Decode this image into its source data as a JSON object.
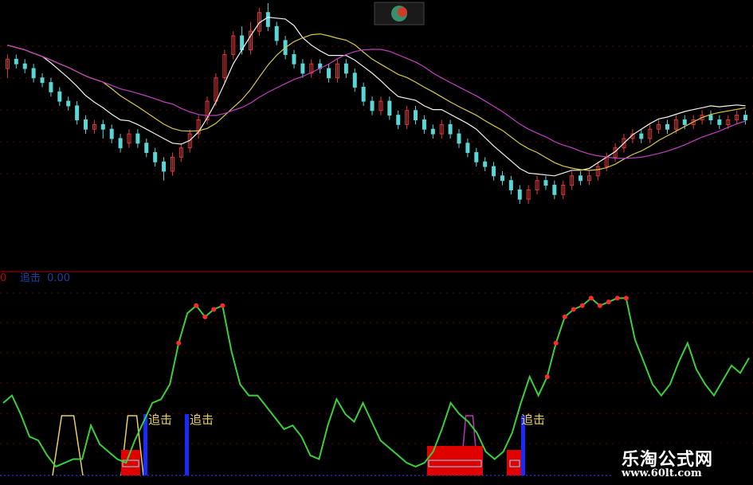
{
  "watermark": {
    "site_name": "乐淘公式网",
    "url": "www.60lt.com"
  },
  "legend": {
    "prefix": "0",
    "indicator_name": "追击",
    "indicator_value": "0.00"
  },
  "colors": {
    "background": "#000000",
    "up_candle": "#e03a3a",
    "down_candle": "#5ad6d6",
    "ma_short": "#f2f2f2",
    "ma_mid": "#d8c850",
    "ma_long": "#c040c0",
    "oscillator": "#3ad03a",
    "signal_dot": "#ff2a2a",
    "grid": "#6a0000",
    "chase_bar": "#1a2aff",
    "yellow_signal": "#e8d060",
    "magenta_signal": "#c030c0",
    "red_block": "#e00000"
  },
  "chart_data": [
    {
      "type": "candlestick",
      "panel": "price",
      "candles": [
        [
          24,
          26,
          22,
          27
        ],
        [
          26,
          25,
          24,
          27
        ],
        [
          25,
          24,
          23,
          26
        ],
        [
          24,
          22,
          21,
          25
        ],
        [
          22,
          21,
          20,
          23
        ],
        [
          21,
          19,
          18,
          22
        ],
        [
          19,
          17,
          16,
          20
        ],
        [
          17,
          16,
          15,
          18
        ],
        [
          16,
          13,
          12,
          17
        ],
        [
          13,
          11,
          10,
          14
        ],
        [
          11,
          12,
          10,
          13
        ],
        [
          12,
          11,
          9,
          13
        ],
        [
          11,
          9,
          8,
          12
        ],
        [
          9,
          7,
          6,
          10
        ],
        [
          8,
          10,
          7,
          11
        ],
        [
          10,
          8,
          7,
          11
        ],
        [
          8,
          6,
          5,
          9
        ],
        [
          6,
          4,
          3,
          7
        ],
        [
          4,
          2,
          0,
          5
        ],
        [
          2,
          5,
          1,
          6
        ],
        [
          5,
          7,
          4,
          8
        ],
        [
          7,
          10,
          6,
          11
        ],
        [
          10,
          13,
          9,
          14
        ],
        [
          13,
          17,
          12,
          18
        ],
        [
          17,
          22,
          16,
          23
        ],
        [
          22,
          27,
          21,
          28
        ],
        [
          27,
          31,
          26,
          32
        ],
        [
          31,
          28,
          27,
          33
        ],
        [
          28,
          32,
          27,
          34
        ],
        [
          32,
          36,
          31,
          37
        ],
        [
          36,
          33,
          32,
          38
        ],
        [
          33,
          30,
          29,
          34
        ],
        [
          30,
          27,
          26,
          31
        ],
        [
          27,
          25,
          24,
          28
        ],
        [
          25,
          23,
          22,
          26
        ],
        [
          23,
          25,
          22,
          26
        ],
        [
          25,
          24,
          23,
          26
        ],
        [
          24,
          22,
          21,
          25
        ],
        [
          22,
          25,
          21,
          26
        ],
        [
          25,
          23,
          22,
          26
        ],
        [
          23,
          20,
          19,
          24
        ],
        [
          20,
          17,
          16,
          21
        ],
        [
          17,
          15,
          14,
          18
        ],
        [
          15,
          17,
          14,
          18
        ],
        [
          17,
          14,
          13,
          18
        ],
        [
          14,
          12,
          11,
          15
        ],
        [
          12,
          15,
          11,
          16
        ],
        [
          15,
          13,
          12,
          16
        ],
        [
          13,
          11,
          10,
          14
        ],
        [
          11,
          10,
          9,
          12
        ],
        [
          10,
          12,
          9,
          13
        ],
        [
          12,
          10,
          9,
          13
        ],
        [
          10,
          8,
          7,
          11
        ],
        [
          8,
          6,
          5,
          9
        ],
        [
          6,
          4,
          3,
          7
        ],
        [
          4,
          3,
          2,
          5
        ],
        [
          3,
          1,
          0,
          4
        ],
        [
          1,
          0,
          -1,
          2
        ],
        [
          0,
          -2,
          -3,
          1
        ],
        [
          -2,
          -4,
          -5,
          -1
        ],
        [
          -4,
          -2,
          -5,
          -1
        ],
        [
          -2,
          0,
          -3,
          1
        ],
        [
          0,
          -1,
          -2,
          1
        ],
        [
          -1,
          -3,
          -4,
          0
        ],
        [
          -3,
          -1,
          -4,
          0
        ],
        [
          -1,
          1,
          -2,
          2
        ],
        [
          1,
          0,
          -1,
          2
        ],
        [
          0,
          1,
          -1,
          2
        ],
        [
          1,
          3,
          0,
          4
        ],
        [
          3,
          5,
          2,
          6
        ],
        [
          5,
          7,
          4,
          8
        ],
        [
          7,
          9,
          6,
          10
        ],
        [
          9,
          10,
          8,
          11
        ],
        [
          10,
          9,
          8,
          11
        ],
        [
          9,
          11,
          8,
          12
        ],
        [
          11,
          12,
          10,
          13
        ],
        [
          12,
          11,
          10,
          13
        ],
        [
          11,
          13,
          10,
          14
        ],
        [
          13,
          12,
          11,
          14
        ],
        [
          12,
          13,
          11,
          14
        ],
        [
          13,
          14,
          12,
          15
        ],
        [
          14,
          13,
          12,
          15
        ],
        [
          13,
          12,
          11,
          14
        ],
        [
          12,
          13,
          11,
          14
        ],
        [
          13,
          14,
          12,
          15
        ],
        [
          14,
          13,
          12,
          15
        ]
      ],
      "moving_averages": [
        "ma_short",
        "ma_mid",
        "ma_long"
      ]
    },
    {
      "type": "line",
      "panel": "oscillator",
      "indicator": "追击",
      "value": 0.0,
      "ylim": [
        0,
        100
      ],
      "x": [
        0,
        1,
        2,
        3,
        4,
        5,
        6,
        7,
        8,
        9,
        10,
        11,
        12,
        13,
        14,
        15,
        16,
        17,
        18,
        19,
        20,
        21,
        22,
        23,
        24,
        25,
        26,
        27,
        28,
        29,
        30,
        31,
        32,
        33,
        34,
        35,
        36,
        37,
        38,
        39,
        40,
        41,
        42,
        43,
        44,
        45,
        46,
        47,
        48,
        49,
        50,
        51,
        52,
        53,
        54,
        55,
        56,
        57,
        58,
        59,
        60,
        61,
        62,
        63,
        64,
        65,
        66,
        67,
        68,
        69,
        70,
        71,
        72,
        73,
        74,
        75,
        76,
        77,
        78,
        79,
        80,
        81,
        82,
        83,
        84,
        85
      ],
      "values": [
        40,
        44,
        34,
        22,
        20,
        12,
        6,
        8,
        10,
        10,
        28,
        18,
        14,
        10,
        8,
        20,
        30,
        40,
        42,
        50,
        72,
        88,
        92,
        86,
        90,
        92,
        68,
        50,
        44,
        44,
        38,
        32,
        26,
        28,
        22,
        12,
        10,
        28,
        42,
        34,
        30,
        40,
        30,
        20,
        16,
        12,
        8,
        6,
        8,
        14,
        26,
        40,
        34,
        30,
        24,
        14,
        10,
        14,
        24,
        40,
        54,
        44,
        54,
        72,
        86,
        90,
        92,
        96,
        92,
        94,
        96,
        96,
        74,
        62,
        50,
        44,
        50,
        62,
        72,
        58,
        50,
        44,
        52,
        60,
        56,
        64
      ],
      "signal_points": [
        20,
        22,
        23,
        24,
        25,
        62,
        63,
        64,
        65,
        66,
        67,
        68,
        69,
        70,
        71
      ]
    }
  ]
}
